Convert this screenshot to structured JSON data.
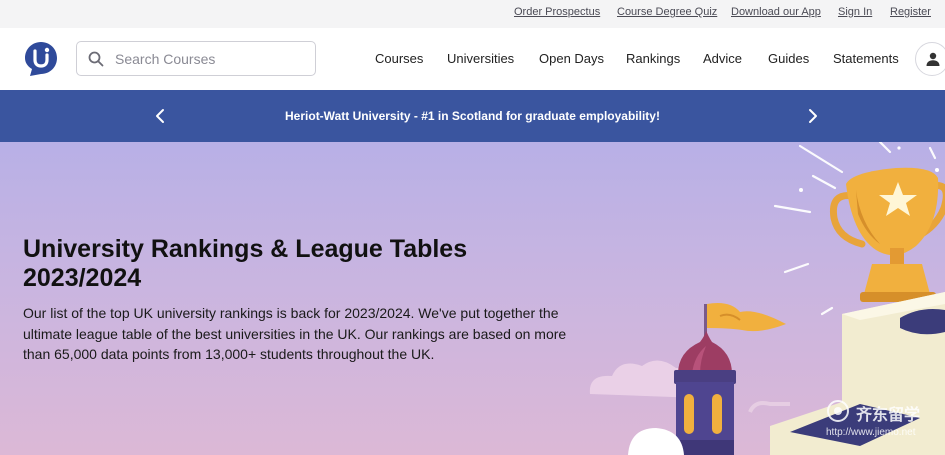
{
  "topbar": {
    "links": [
      "Order Prospectus",
      "Course Degree Quiz",
      "Download our App",
      "Sign In",
      "Register"
    ]
  },
  "header": {
    "search": {
      "placeholder": "Search Courses"
    },
    "nav": [
      "Courses",
      "Universities",
      "Open Days",
      "Rankings",
      "Advice",
      "Guides",
      "Statements"
    ],
    "icons": {
      "logo": "uni-logo-icon",
      "search": "search-icon",
      "user": "user-icon"
    }
  },
  "banner": {
    "text": "Heriot-Watt University - #1 in Scotland for graduate employability!",
    "icons": [
      "chevron-left-icon",
      "chevron-right-icon"
    ]
  },
  "hero": {
    "title": "University Rankings & League Tables 2023/2024",
    "description": "Our list of the top UK university rankings is back for 2023/2024. We've put together the ultimate league table of the best universities in the UK. Our rankings are based on more than 65,000 data points from 13,000+ students throughout the UK.",
    "illustration": "trophy-podium-tower-illustration"
  },
  "watermark": {
    "brand": "齐东留学",
    "url": "http://www.jiemo.net"
  },
  "colors": {
    "brand_blue": "#3a559f",
    "logo_blue": "#2f4a9a",
    "hero_top": "#b8b0e6",
    "hero_bottom": "#dcb8d6"
  }
}
